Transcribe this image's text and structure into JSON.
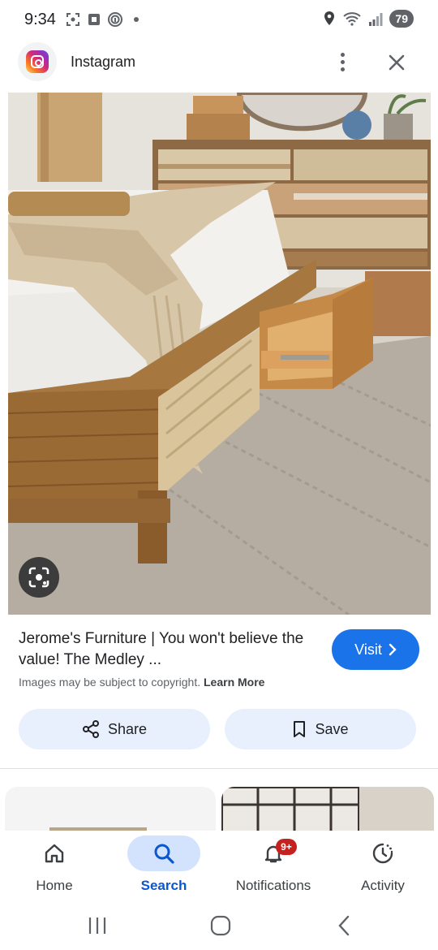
{
  "status_bar": {
    "time": "9:34",
    "battery_level": "79",
    "left_icons": [
      "screenshot-icon",
      "media-icon",
      "fingerprint-icon",
      "dot-icon"
    ],
    "right_icons": [
      "location-icon",
      "wifi-icon",
      "signal-icon"
    ]
  },
  "header": {
    "app_name": "Instagram",
    "app_icon": "instagram-logo",
    "more_icon": "more-vert-icon",
    "close_icon": "close-icon"
  },
  "image": {
    "subject": "wooden storage bed with open drawer, dresser and rug",
    "lens_icon": "google-lens-icon"
  },
  "description": {
    "title": "Jerome's Furniture | You won't believe the value! The Medley ...",
    "copyright_text": "Images may be subject to copyright.",
    "learn_more": "Learn More",
    "visit_label": "Visit"
  },
  "actions": {
    "share_label": "Share",
    "save_label": "Save"
  },
  "bottom_nav": {
    "items": [
      {
        "label": "Home",
        "icon": "home-icon",
        "active": false
      },
      {
        "label": "Search",
        "icon": "search-icon",
        "active": true
      },
      {
        "label": "Notifications",
        "icon": "bell-icon",
        "active": false,
        "badge": "9+"
      },
      {
        "label": "Activity",
        "icon": "activity-icon",
        "active": false
      }
    ]
  },
  "colors": {
    "accent": "#1a73e8",
    "active_pill": "#d3e3fd",
    "action_bg": "#e8f0fe",
    "badge": "#c5221f"
  }
}
